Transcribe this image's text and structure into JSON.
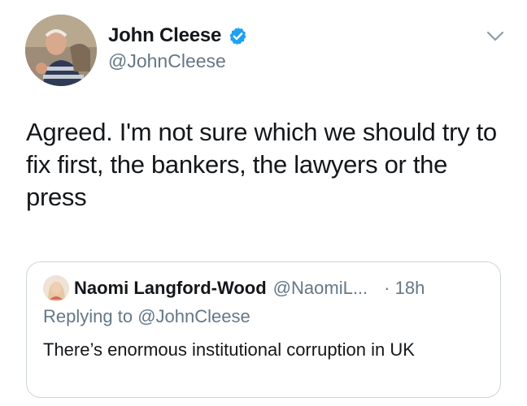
{
  "author": {
    "name": "John Cleese",
    "handle": "@JohnCleese"
  },
  "tweet": {
    "text": "Agreed. I'm not sure which we should try to fix first, the bankers, the lawyers or the press"
  },
  "quoted_tweet": {
    "name": "Naomi Langford-Wood",
    "handle": "@NaomiL...",
    "time": "· 18h",
    "replying_label": "Replying to",
    "replying_to": "@JohnCleese",
    "text": "There’s enormous institutional corruption in UK"
  },
  "icons": {
    "verified": "verified-badge-icon",
    "menu": "chevron-down-icon"
  },
  "colors": {
    "verified_blue": "#1da1f2",
    "secondary_text": "#657786",
    "border": "#ccd6dd"
  }
}
